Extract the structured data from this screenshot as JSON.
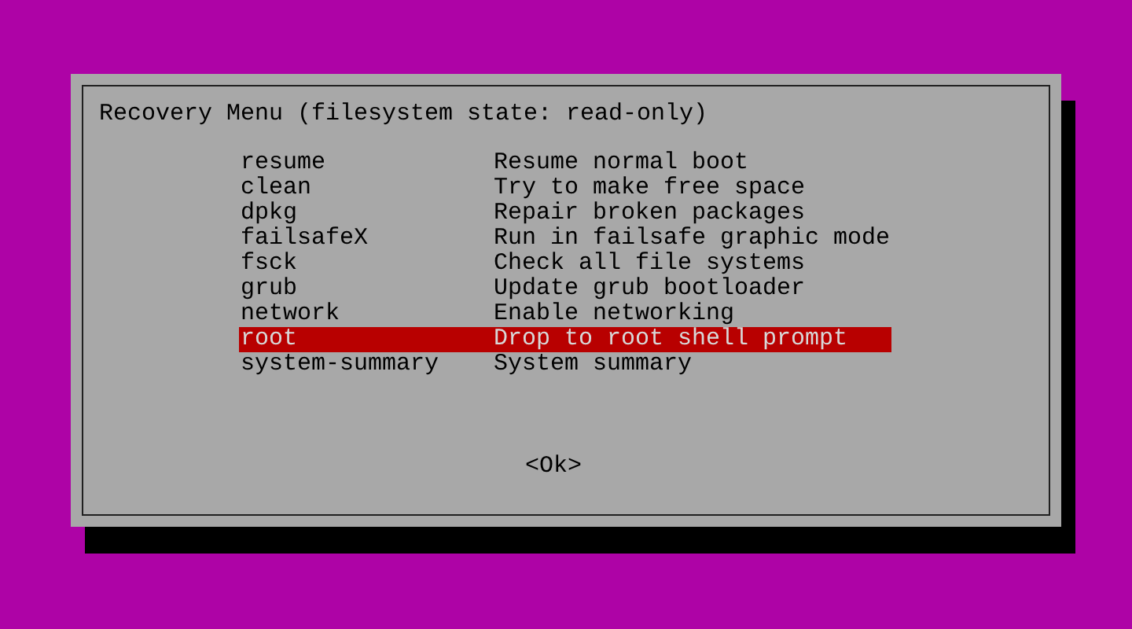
{
  "dialog": {
    "title": "Recovery Menu (filesystem state: read-only)",
    "items": [
      {
        "tag": "resume",
        "description": "Resume normal boot",
        "selected": false
      },
      {
        "tag": "clean",
        "description": "Try to make free space",
        "selected": false
      },
      {
        "tag": "dpkg",
        "description": "Repair broken packages",
        "selected": false
      },
      {
        "tag": "failsafeX",
        "description": "Run in failsafe graphic mode",
        "selected": false
      },
      {
        "tag": "fsck",
        "description": "Check all file systems",
        "selected": false
      },
      {
        "tag": "grub",
        "description": "Update grub bootloader",
        "selected": false
      },
      {
        "tag": "network",
        "description": "Enable networking",
        "selected": false
      },
      {
        "tag": "root",
        "description": "Drop to root shell prompt",
        "selected": true
      },
      {
        "tag": "system-summary",
        "description": "System summary",
        "selected": false
      }
    ],
    "button": "<Ok>"
  }
}
